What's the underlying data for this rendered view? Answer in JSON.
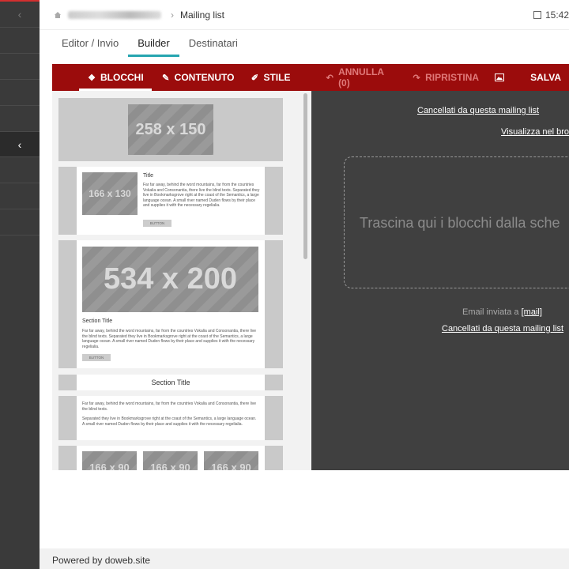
{
  "sidebar": {
    "collapse_icon": "‹",
    "active_icon": "‹"
  },
  "header": {
    "breadcrumb_current": "Mailing list",
    "time": "15:42"
  },
  "tabs": [
    {
      "label": "Editor / Invio"
    },
    {
      "label": "Builder"
    },
    {
      "label": "Destinatari"
    }
  ],
  "toolbar": {
    "blocchi": "BLOCCHI",
    "contenuto": "CONTENUTO",
    "stile": "STILE",
    "annulla": "ANNULLA (0)",
    "ripristina": "RIPRISTINA",
    "salva": "SALVA"
  },
  "blocks": {
    "b1_ph": "258 x 150",
    "b2_ph": "166 x 130",
    "b2_title": "Title",
    "b2_text": "Far far away, behind the word mountains, far from the countries Vokalia and Consonantia, there live the blind texts. Separated they live in Bookmarksgrove right at the coast of the Semantics, a large language ocean. A small river named Duden flows by their place and supplies it with the necessary regelialia.",
    "b2_btn": "BUTTON",
    "b3_ph": "534 x 200",
    "b3_title": "Section Title",
    "b3_text": "Far far away, behind the word mountains, far from the countries Vokalia and Consonantia, there live the blind texts. Separated they live in Bookmarksgrove right at the coast of the Semantics, a large language ocean. A small river named Duden flows by their place and supplies it with the necessary regelialia.",
    "b3_btn": "BUTTON",
    "b4_title": "Section Title",
    "b5_text1": "Far far away, behind the word mountains, far from the countries Vokalia and Consonantia, there live the blind texts.",
    "b5_text2": "Separated they live in Bookmarksgrove right at the coast of the Semantics, a large language ocean. A small river named Duden flows by their place and supplies it with the necessary regelialia.",
    "b6_ph": "166 x 90"
  },
  "canvas": {
    "unsubscribe_top": "Cancellati da questa mailing list",
    "view_browser": "Visualizza nel brow",
    "drop_text": "Trascina qui i blocchi dalla sche",
    "sent_to": "Email inviata a",
    "mail": "[mail]",
    "unsubscribe_bottom": "Cancellati da questa mailing list"
  },
  "footer": {
    "powered": "Powered by doweb.site"
  },
  "colors": {
    "toolbar": "#9b0c0c",
    "tab_accent": "#26a5b0",
    "sidebar": "#3a3a3a",
    "canvas": "#404040"
  }
}
